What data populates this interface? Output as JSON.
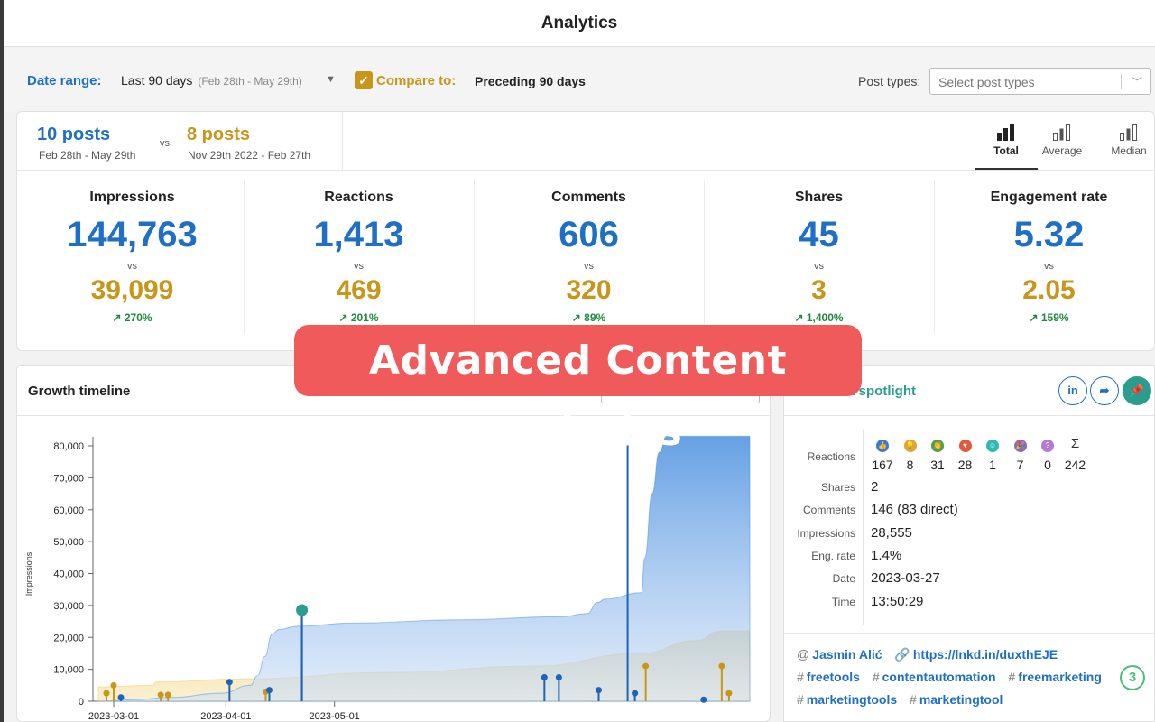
{
  "header": {
    "title": "Analytics"
  },
  "filters": {
    "date_range_label": "Date range:",
    "date_range_value": "Last 90 days",
    "date_range_sub": "(Feb 28th - May 29th)",
    "compare_checked": true,
    "compare_label": "Compare to:",
    "compare_value": "Preceding 90 days",
    "post_types_label": "Post types:",
    "post_types_placeholder": "Select post types"
  },
  "summary": {
    "current_posts": "10 posts",
    "current_dates": "Feb 28th - May 29th",
    "vs": "vs",
    "previous_posts": "8 posts",
    "previous_dates": "Nov 29th 2022 - Feb 27th",
    "aggregations": [
      {
        "label": "Total",
        "active": true,
        "icon": "bar-chart-icon"
      },
      {
        "label": "Average",
        "active": false,
        "icon": "bar-chart-icon"
      },
      {
        "label": "Median",
        "active": false,
        "icon": "bar-chart-icon"
      }
    ],
    "metrics": [
      {
        "name": "Impressions",
        "value": "144,763",
        "vs": "vs",
        "previous": "39,099",
        "change": "↗ 270%"
      },
      {
        "name": "Reactions",
        "value": "1,413",
        "vs": "vs",
        "previous": "469",
        "change": "↗ 201%"
      },
      {
        "name": "Comments",
        "value": "606",
        "vs": "vs",
        "previous": "320",
        "change": "↗ 89%"
      },
      {
        "name": "Shares",
        "value": "45",
        "vs": "vs",
        "previous": "3",
        "change": "↗ 1,400%"
      },
      {
        "name": "Engagement rate",
        "value": "5.32",
        "vs": "vs",
        "previous": "2.05",
        "change": "↗ 159%"
      }
    ],
    "colors": {
      "current": "#1f6fc4",
      "previous": "#c8961a",
      "positive": "#1f8a3e"
    }
  },
  "timeline": {
    "title": "Growth timeline",
    "chart_data": {
      "type": "area",
      "ylabel": "Impressions",
      "ylim": [
        0,
        80000
      ],
      "yticks": [
        "80,000",
        "70,000",
        "60,000",
        "50,000",
        "40,000",
        "30,000",
        "20,000",
        "10,000",
        "0"
      ],
      "xticks": [
        "2023-03-01",
        "2023-04-01",
        "2023-05-01"
      ],
      "series": [
        {
          "color": "#4a8fe0",
          "cumulative": [
            [
              0,
              0
            ],
            [
              10,
              500
            ],
            [
              20,
              1200
            ],
            [
              34,
              2500
            ],
            [
              42,
              5000
            ],
            [
              44,
              8000
            ],
            [
              46,
              14000
            ],
            [
              48,
              21000
            ],
            [
              50,
              22500
            ],
            [
              55,
              23500
            ],
            [
              70,
              24500
            ],
            [
              100,
              25500
            ],
            [
              128,
              26500
            ],
            [
              135,
              27500
            ],
            [
              138,
              31000
            ],
            [
              140,
              32000
            ],
            [
              150,
              34000
            ],
            [
              151,
              45000
            ],
            [
              153,
              65000
            ],
            [
              155,
              78000
            ],
            [
              157,
              83000
            ],
            [
              180,
              83000
            ]
          ],
          "posts": [
            [
              2,
              1200
            ],
            [
              32,
              6000
            ],
            [
              43,
              3500
            ],
            [
              52,
              28555
            ],
            [
              119,
              7500
            ],
            [
              123,
              7500
            ],
            [
              134,
              3500
            ],
            [
              142,
              83000
            ],
            [
              144,
              2500
            ],
            [
              163,
              500
            ]
          ]
        },
        {
          "color": "#f0c860",
          "cumulative": [
            [
              0,
              4500
            ],
            [
              15,
              5000
            ],
            [
              16,
              6000
            ],
            [
              40,
              7000
            ],
            [
              80,
              9000
            ],
            [
              120,
              11000
            ],
            [
              150,
              15000
            ],
            [
              165,
              19000
            ],
            [
              172,
              22000
            ],
            [
              180,
              22000
            ]
          ],
          "posts": [
            [
              -2,
              2500
            ],
            [
              0,
              5000
            ],
            [
              13,
              2000
            ],
            [
              15,
              2000
            ],
            [
              42,
              3000
            ],
            [
              147,
              11000
            ],
            [
              168,
              11000
            ],
            [
              170,
              2500
            ]
          ]
        }
      ],
      "highlight_post": [
        52,
        28555
      ],
      "x_days_span": 180
    }
  },
  "spotlight": {
    "title": "Post spotlight",
    "reactions_label": "Reactions",
    "reactions": [
      {
        "icon": "like-icon",
        "color": "#3b79d6",
        "count": "167"
      },
      {
        "icon": "insightful-icon",
        "color": "#e0a431",
        "count": "8"
      },
      {
        "icon": "support-icon",
        "color": "#4f9d4a",
        "count": "31"
      },
      {
        "icon": "love-icon",
        "color": "#e0593b",
        "count": "28"
      },
      {
        "icon": "funny-icon",
        "color": "#2fb9b4",
        "count": "1"
      },
      {
        "icon": "celebrate-icon",
        "color": "#8a6bb8",
        "count": "7"
      },
      {
        "icon": "curious-icon",
        "color": "#b57ad0",
        "count": "0"
      },
      {
        "icon": "sum-icon",
        "color": "#333333",
        "count": "242",
        "glyph": "Σ"
      }
    ],
    "rows": [
      {
        "key": "Shares",
        "value": "2"
      },
      {
        "key": "Comments",
        "value": "146 (83 direct)"
      },
      {
        "key": "Impressions",
        "value": "28,555"
      },
      {
        "key": "Eng. rate",
        "value": "1.4%"
      },
      {
        "key": "Date",
        "value": "2023-03-27"
      },
      {
        "key": "Time",
        "value": "13:50:29"
      }
    ],
    "author": "Jasmin Alić",
    "link": "https://lnkd.in/duxthEJE",
    "hashtags_line1": [
      "freetools",
      "contentautomation",
      "freemarketing"
    ],
    "hashtags_line2": [
      "marketingtools",
      "marketingtool"
    ],
    "hashtag_count": "3",
    "buttons": {
      "linkedin": "in",
      "share": "➦",
      "pin": "📌"
    }
  },
  "banner": {
    "text": "Advanced Content Analytics"
  }
}
